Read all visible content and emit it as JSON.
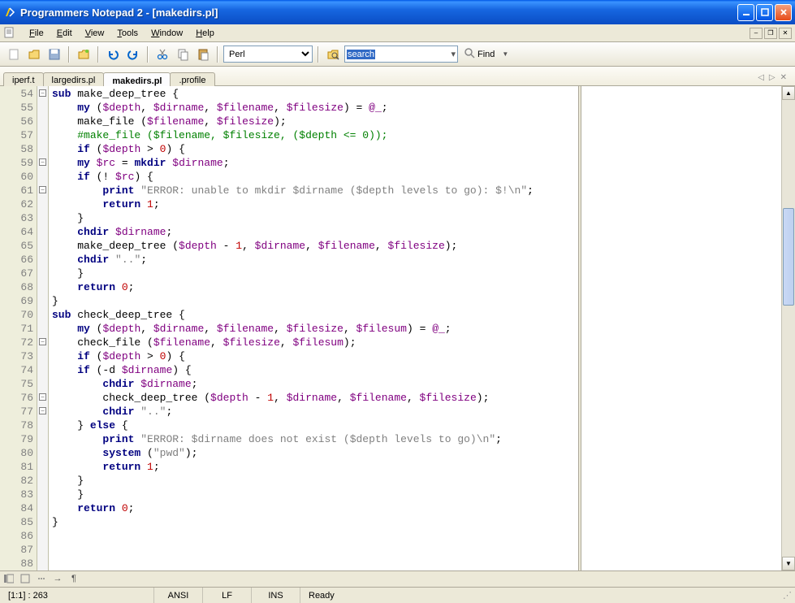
{
  "window": {
    "title": "Programmers Notepad 2 - [makedirs.pl]"
  },
  "menu": {
    "items": [
      "File",
      "Edit",
      "View",
      "Tools",
      "Window",
      "Help"
    ]
  },
  "toolbar": {
    "language_selected": "Perl",
    "search_text": "search",
    "find_label": "Find"
  },
  "tabs": {
    "items": [
      "iperf.t",
      "largedirs.pl",
      "makedirs.pl",
      ".profile"
    ],
    "active_index": 2
  },
  "editor": {
    "first_line": 54,
    "line_count": 35,
    "fold_markers": {
      "0": "minus",
      "5": "minus",
      "7": "minus",
      "18": "minus",
      "22": "minus",
      "23": "minus"
    },
    "code_lines": [
      [
        [
          "k",
          "sub"
        ],
        [
          "p",
          " make_deep_tree {"
        ]
      ],
      [
        [
          "p",
          "    "
        ],
        [
          "k",
          "my"
        ],
        [
          "p",
          " ("
        ],
        [
          "v",
          "$depth"
        ],
        [
          "p",
          ", "
        ],
        [
          "v",
          "$dirname"
        ],
        [
          "p",
          ", "
        ],
        [
          "v",
          "$filename"
        ],
        [
          "p",
          ", "
        ],
        [
          "v",
          "$filesize"
        ],
        [
          "p",
          ") = "
        ],
        [
          "v",
          "@_"
        ],
        [
          "p",
          ";"
        ]
      ],
      [
        [
          "p",
          ""
        ]
      ],
      [
        [
          "p",
          "    make_file ("
        ],
        [
          "v",
          "$filename"
        ],
        [
          "p",
          ", "
        ],
        [
          "v",
          "$filesize"
        ],
        [
          "p",
          ");"
        ]
      ],
      [
        [
          "p",
          "    "
        ],
        [
          "c",
          "#make_file ($filename, $filesize, ($depth <= 0));"
        ]
      ],
      [
        [
          "p",
          "    "
        ],
        [
          "k",
          "if"
        ],
        [
          "p",
          " ("
        ],
        [
          "v",
          "$depth"
        ],
        [
          "p",
          " > "
        ],
        [
          "n",
          "0"
        ],
        [
          "p",
          ") {"
        ]
      ],
      [
        [
          "p",
          "    "
        ],
        [
          "k",
          "my"
        ],
        [
          "p",
          " "
        ],
        [
          "v",
          "$rc"
        ],
        [
          "p",
          " = "
        ],
        [
          "k",
          "mkdir"
        ],
        [
          "p",
          " "
        ],
        [
          "v",
          "$dirname"
        ],
        [
          "p",
          ";"
        ]
      ],
      [
        [
          "p",
          "    "
        ],
        [
          "k",
          "if"
        ],
        [
          "p",
          " (! "
        ],
        [
          "v",
          "$rc"
        ],
        [
          "p",
          ") {"
        ]
      ],
      [
        [
          "p",
          "        "
        ],
        [
          "k",
          "print"
        ],
        [
          "p",
          " "
        ],
        [
          "s",
          "\"ERROR: unable to mkdir $dirname ($depth levels to go): $!\\n\""
        ],
        [
          "p",
          ";"
        ]
      ],
      [
        [
          "p",
          "        "
        ],
        [
          "k",
          "return"
        ],
        [
          "p",
          " "
        ],
        [
          "n",
          "1"
        ],
        [
          "p",
          ";"
        ]
      ],
      [
        [
          "p",
          "    }"
        ]
      ],
      [
        [
          "p",
          "    "
        ],
        [
          "k",
          "chdir"
        ],
        [
          "p",
          " "
        ],
        [
          "v",
          "$dirname"
        ],
        [
          "p",
          ";"
        ]
      ],
      [
        [
          "p",
          "    make_deep_tree ("
        ],
        [
          "v",
          "$depth"
        ],
        [
          "p",
          " - "
        ],
        [
          "n",
          "1"
        ],
        [
          "p",
          ", "
        ],
        [
          "v",
          "$dirname"
        ],
        [
          "p",
          ", "
        ],
        [
          "v",
          "$filename"
        ],
        [
          "p",
          ", "
        ],
        [
          "v",
          "$filesize"
        ],
        [
          "p",
          ");"
        ]
      ],
      [
        [
          "p",
          "    "
        ],
        [
          "k",
          "chdir"
        ],
        [
          "p",
          " "
        ],
        [
          "s",
          "\"..\""
        ],
        [
          "p",
          ";"
        ]
      ],
      [
        [
          "p",
          "    }"
        ]
      ],
      [
        [
          "p",
          "    "
        ],
        [
          "k",
          "return"
        ],
        [
          "p",
          " "
        ],
        [
          "n",
          "0"
        ],
        [
          "p",
          ";"
        ]
      ],
      [
        [
          "p",
          "}"
        ]
      ],
      [
        [
          "p",
          ""
        ]
      ],
      [
        [
          "k",
          "sub"
        ],
        [
          "p",
          " check_deep_tree {"
        ]
      ],
      [
        [
          "p",
          "    "
        ],
        [
          "k",
          "my"
        ],
        [
          "p",
          " ("
        ],
        [
          "v",
          "$depth"
        ],
        [
          "p",
          ", "
        ],
        [
          "v",
          "$dirname"
        ],
        [
          "p",
          ", "
        ],
        [
          "v",
          "$filename"
        ],
        [
          "p",
          ", "
        ],
        [
          "v",
          "$filesize"
        ],
        [
          "p",
          ", "
        ],
        [
          "v",
          "$filesum"
        ],
        [
          "p",
          ") = "
        ],
        [
          "v",
          "@_"
        ],
        [
          "p",
          ";"
        ]
      ],
      [
        [
          "p",
          ""
        ]
      ],
      [
        [
          "p",
          "    check_file ("
        ],
        [
          "v",
          "$filename"
        ],
        [
          "p",
          ", "
        ],
        [
          "v",
          "$filesize"
        ],
        [
          "p",
          ", "
        ],
        [
          "v",
          "$filesum"
        ],
        [
          "p",
          ");"
        ]
      ],
      [
        [
          "p",
          "    "
        ],
        [
          "k",
          "if"
        ],
        [
          "p",
          " ("
        ],
        [
          "v",
          "$depth"
        ],
        [
          "p",
          " > "
        ],
        [
          "n",
          "0"
        ],
        [
          "p",
          ") {"
        ]
      ],
      [
        [
          "p",
          "    "
        ],
        [
          "k",
          "if"
        ],
        [
          "p",
          " (-d "
        ],
        [
          "v",
          "$dirname"
        ],
        [
          "p",
          ") {"
        ]
      ],
      [
        [
          "p",
          "        "
        ],
        [
          "k",
          "chdir"
        ],
        [
          "p",
          " "
        ],
        [
          "v",
          "$dirname"
        ],
        [
          "p",
          ";"
        ]
      ],
      [
        [
          "p",
          "        check_deep_tree ("
        ],
        [
          "v",
          "$depth"
        ],
        [
          "p",
          " - "
        ],
        [
          "n",
          "1"
        ],
        [
          "p",
          ", "
        ],
        [
          "v",
          "$dirname"
        ],
        [
          "p",
          ", "
        ],
        [
          "v",
          "$filename"
        ],
        [
          "p",
          ", "
        ],
        [
          "v",
          "$filesize"
        ],
        [
          "p",
          ");"
        ]
      ],
      [
        [
          "p",
          "        "
        ],
        [
          "k",
          "chdir"
        ],
        [
          "p",
          " "
        ],
        [
          "s",
          "\"..\""
        ],
        [
          "p",
          ";"
        ]
      ],
      [
        [
          "p",
          "    } "
        ],
        [
          "k",
          "else"
        ],
        [
          "p",
          " {"
        ]
      ],
      [
        [
          "p",
          "        "
        ],
        [
          "k",
          "print"
        ],
        [
          "p",
          " "
        ],
        [
          "s",
          "\"ERROR: $dirname does not exist ($depth levels to go)\\n\""
        ],
        [
          "p",
          ";"
        ]
      ],
      [
        [
          "p",
          "        "
        ],
        [
          "k",
          "system"
        ],
        [
          "p",
          " ("
        ],
        [
          "s",
          "\"pwd\""
        ],
        [
          "p",
          ");"
        ]
      ],
      [
        [
          "p",
          "        "
        ],
        [
          "k",
          "return"
        ],
        [
          "p",
          " "
        ],
        [
          "n",
          "1"
        ],
        [
          "p",
          ";"
        ]
      ],
      [
        [
          "p",
          "    }"
        ]
      ],
      [
        [
          "p",
          "    }"
        ]
      ],
      [
        [
          "p",
          "    "
        ],
        [
          "k",
          "return"
        ],
        [
          "p",
          " "
        ],
        [
          "n",
          "0"
        ],
        [
          "p",
          ";"
        ]
      ],
      [
        [
          "p",
          "}"
        ]
      ]
    ]
  },
  "bottombar": {
    "pilcrow": "¶"
  },
  "status": {
    "pos": "[1:1] : 263",
    "encoding": "ANSI",
    "line_ending": "LF",
    "mode": "INS",
    "state": "Ready"
  }
}
